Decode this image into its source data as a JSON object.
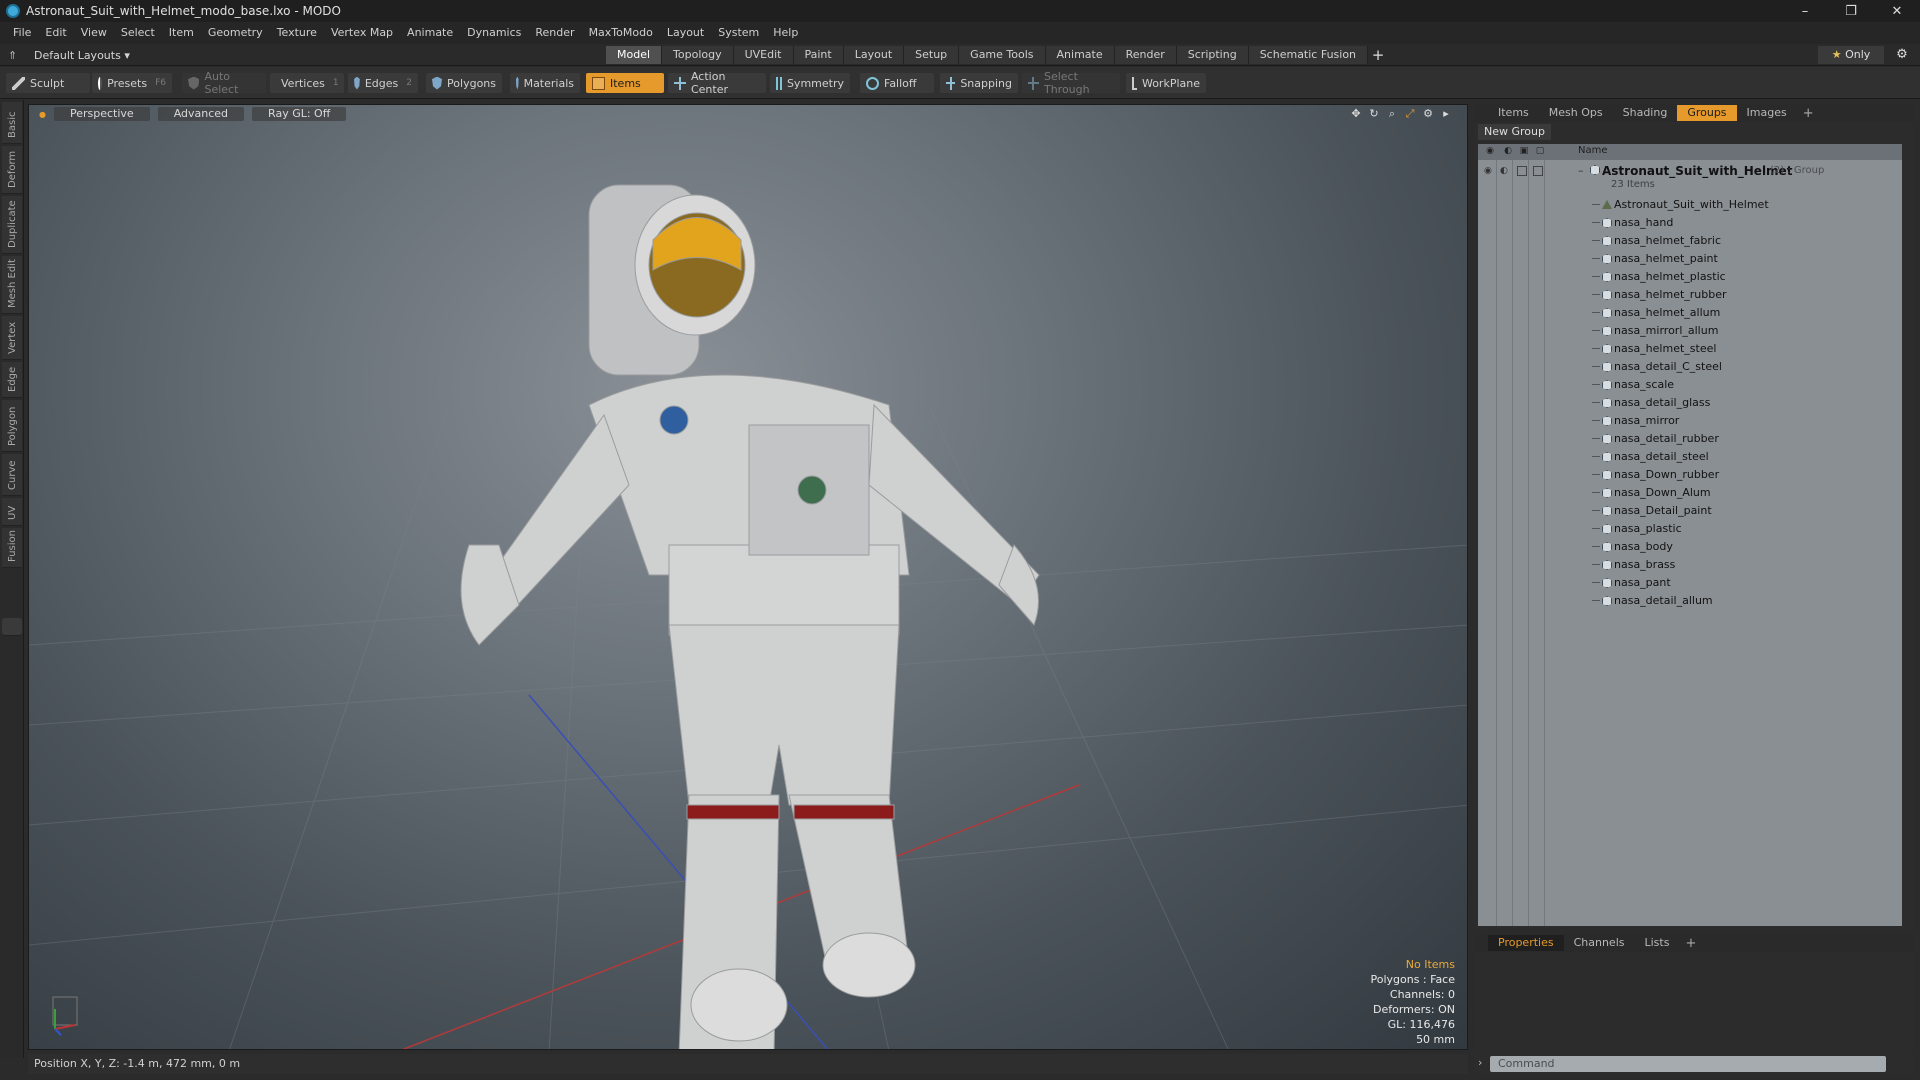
{
  "window": {
    "title": "Astronaut_Suit_with_Helmet_modo_base.lxo - MODO",
    "controls": [
      "–",
      "❐",
      "✕"
    ]
  },
  "menu": [
    "File",
    "Edit",
    "View",
    "Select",
    "Item",
    "Geometry",
    "Texture",
    "Vertex Map",
    "Animate",
    "Dynamics",
    "Render",
    "MaxToModo",
    "Layout",
    "System",
    "Help"
  ],
  "layout_bar": {
    "layouts_label": "Default Layouts",
    "tabs": [
      "Model",
      "Topology",
      "UVEdit",
      "Paint",
      "Layout",
      "Setup",
      "Game Tools",
      "Animate",
      "Render",
      "Scripting",
      "Schematic Fusion"
    ],
    "active_tab": "Model",
    "add_label": "+",
    "only_star": "★",
    "only_label": "Only"
  },
  "toolbar": {
    "sculpt": "Sculpt",
    "presets": "Presets",
    "presets_key": "F6",
    "auto_select": "Auto Select",
    "vertices": "Vertices",
    "vertices_key": "1",
    "edges": "Edges",
    "edges_key": "2",
    "polygons": "Polygons",
    "materials": "Materials",
    "items": "Items",
    "action_center": "Action Center",
    "symmetry": "Symmetry",
    "falloff": "Falloff",
    "snapping": "Snapping",
    "select_through": "Select Through",
    "workplane": "WorkPlane"
  },
  "left_tabs": [
    "Basic",
    "Deform",
    "Duplicate",
    "Mesh Edit",
    "Vertex",
    "Edge",
    "Polygon",
    "Curve",
    "UV",
    "Fusion"
  ],
  "viewport": {
    "view_mode": "Perspective",
    "shading": "Advanced",
    "raygl": "Ray GL: Off",
    "info": {
      "selection": "No Items",
      "polygons": "Polygons : Face",
      "channels": "Channels: 0",
      "deformers": "Deformers: ON",
      "gl": "GL: 116,476",
      "scale": "50 mm"
    }
  },
  "status": {
    "position": "Position X, Y, Z:  -1.4 m, 472 mm, 0 m"
  },
  "right_panel": {
    "tabs": [
      "Items",
      "Mesh Ops",
      "Shading",
      "Groups",
      "Images"
    ],
    "active_tab": "Groups",
    "new_group": "New Group",
    "column_name": "Name",
    "group": {
      "name": "Astronaut_Suit_with_Helmet",
      "meta": "(2) : Group",
      "count": "23 Items"
    },
    "items": [
      {
        "label": "Astronaut_Suit_with_Helmet",
        "icon": "locator-icon"
      },
      {
        "label": "nasa_hand",
        "icon": "mesh-icon"
      },
      {
        "label": "nasa_helmet_fabric",
        "icon": "mesh-icon"
      },
      {
        "label": "nasa_helmet_paint",
        "icon": "mesh-icon"
      },
      {
        "label": "nasa_helmet_plastic",
        "icon": "mesh-icon"
      },
      {
        "label": "nasa_helmet_rubber",
        "icon": "mesh-icon"
      },
      {
        "label": "nasa_helmet_allum",
        "icon": "mesh-icon"
      },
      {
        "label": "nasa_mirrorl_allum",
        "icon": "mesh-icon"
      },
      {
        "label": "nasa_helmet_steel",
        "icon": "mesh-icon"
      },
      {
        "label": "nasa_detail_C_steel",
        "icon": "mesh-icon"
      },
      {
        "label": "nasa_scale",
        "icon": "mesh-icon"
      },
      {
        "label": "nasa_detail_glass",
        "icon": "mesh-icon"
      },
      {
        "label": "nasa_mirror",
        "icon": "mesh-icon"
      },
      {
        "label": "nasa_detail_rubber",
        "icon": "mesh-icon"
      },
      {
        "label": "nasa_detail_steel",
        "icon": "mesh-icon"
      },
      {
        "label": "nasa_Down_rubber",
        "icon": "mesh-icon"
      },
      {
        "label": "nasa_Down_Alum",
        "icon": "mesh-icon"
      },
      {
        "label": "nasa_Detail_paint",
        "icon": "mesh-icon"
      },
      {
        "label": "nasa_plastic",
        "icon": "mesh-icon"
      },
      {
        "label": "nasa_body",
        "icon": "mesh-icon"
      },
      {
        "label": "nasa_brass",
        "icon": "mesh-icon"
      },
      {
        "label": "nasa_pant",
        "icon": "mesh-icon"
      },
      {
        "label": "nasa_detail_allum",
        "icon": "mesh-icon"
      }
    ]
  },
  "bottom_panel": {
    "tabs": [
      "Properties",
      "Channels",
      "Lists"
    ],
    "active_tab": "Properties"
  },
  "command": {
    "placeholder": "Command"
  },
  "colors": {
    "accent": "#e59a2b",
    "background": "#2b2b2b",
    "list_bg": "#8a8f94"
  }
}
